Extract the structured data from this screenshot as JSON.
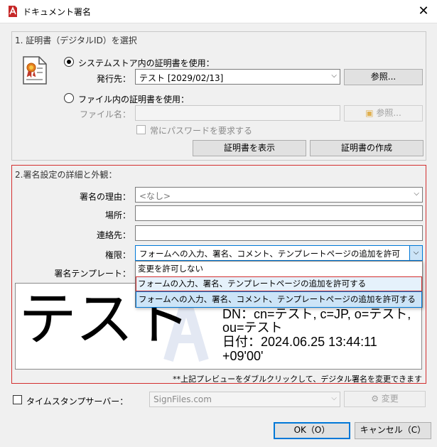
{
  "window": {
    "title": "ドキュメント署名",
    "close_glyph": "✕"
  },
  "section1": {
    "title": "1. 証明書（デジタルID）を選択",
    "radio_store": "システムストア内の証明書を使用：",
    "issuer_label": "発行先：",
    "issuer_value": "テスト [2029/02/13]",
    "browse_label": "参照...",
    "radio_file": "ファイル内の証明書を使用：",
    "filename_label": "ファイル名：",
    "filename_value": "",
    "browse_file_label": "参照...",
    "always_password": "常にパスワードを要求する",
    "show_cert": "証明書を表示",
    "create_cert": "証明書の作成"
  },
  "section2": {
    "title": "2.署名設定の詳細と外観：",
    "reason_label": "署名の理由：",
    "reason_value": "<なし>",
    "location_label": "場所：",
    "location_value": "",
    "contact_label": "連絡先：",
    "contact_value": "",
    "permission_label": "権限：",
    "permission_value": "フォームへの入力、署名、コメント、テンプレートページの追加を許可",
    "template_label": "署名テンプレート：",
    "permission_options": [
      "変更を許可しない",
      "フォームの入力、署名、テンプレートページの追加を許可する",
      "フォームへの入力、署名、コメント、テンプレートページの追加を許可する"
    ],
    "preview": {
      "name": "テスト",
      "line1": "DN：cn=テスト, c=JP, o=テスト,",
      "line2": "ou=テスト",
      "line3": "日付：2024.06.25 13:44:11",
      "line4": "+09'00'"
    },
    "hint": "**上記プレビューをダブルクリックして、デジタル署名を変更できます"
  },
  "timestamp": {
    "label": "タイムスタンプサーバー：",
    "server": "SignFiles.com",
    "change_label": "変更"
  },
  "footer": {
    "ok_label": "OK（O）",
    "cancel_label": "キャンセル（C）"
  },
  "colors": {
    "accent": "#0078d7",
    "highlight_border": "#d32f2f",
    "app_icon": "#c62828"
  }
}
